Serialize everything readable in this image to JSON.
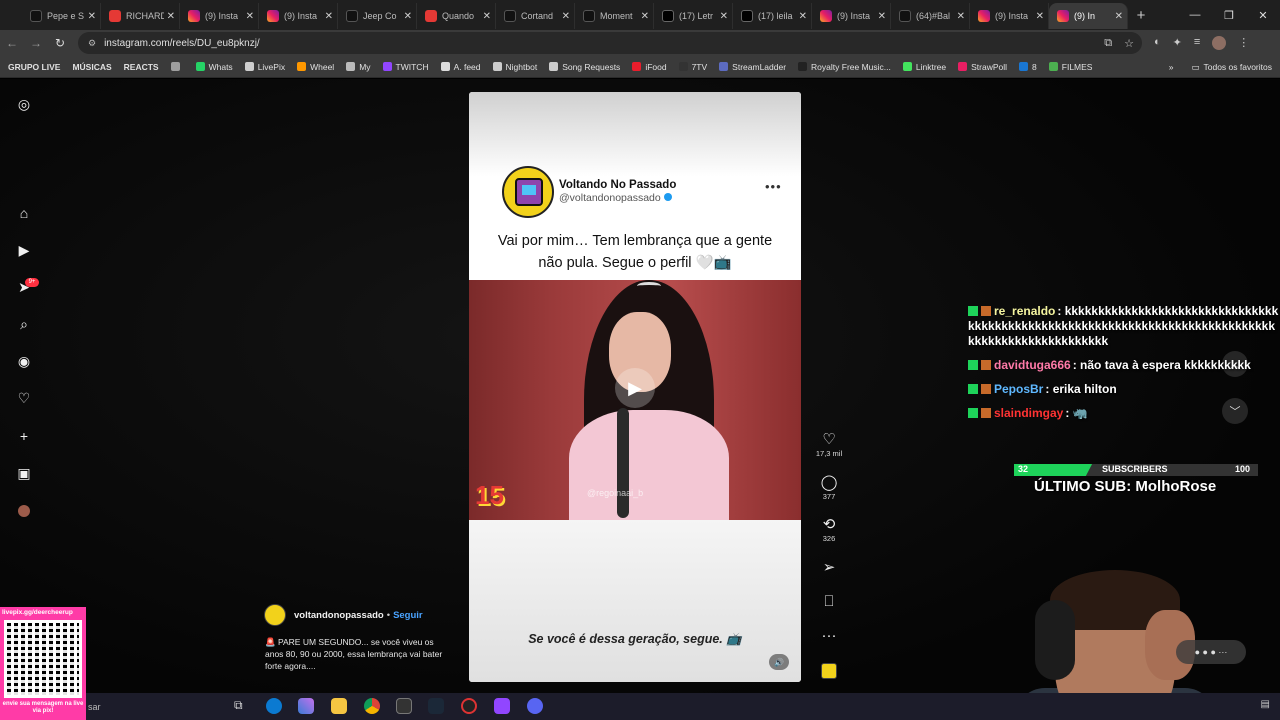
{
  "tabs": [
    {
      "label": "Pepe e S",
      "icon": "tiktok-icon",
      "kind": "tt"
    },
    {
      "label": "RICHARD",
      "icon": "youtube-icon",
      "kind": "yt"
    },
    {
      "label": "(9) Insta",
      "icon": "instagram-icon",
      "kind": "ig"
    },
    {
      "label": "(9) Insta",
      "icon": "instagram-icon",
      "kind": "ig"
    },
    {
      "label": "Jeep Co",
      "icon": "tiktok-icon",
      "kind": "tt"
    },
    {
      "label": "Quando",
      "icon": "youtube-icon",
      "kind": "yt"
    },
    {
      "label": "Cortand",
      "icon": "tiktok-icon",
      "kind": "tt"
    },
    {
      "label": "Moment",
      "icon": "tiktok-icon",
      "kind": "tt"
    },
    {
      "label": "(17) Letr",
      "icon": "x-icon",
      "kind": "xx"
    },
    {
      "label": "(17) leila",
      "icon": "x-icon",
      "kind": "xx"
    },
    {
      "label": "(9) Insta",
      "icon": "instagram-icon",
      "kind": "ig"
    },
    {
      "label": "(64)#Bal",
      "icon": "tiktok-icon",
      "kind": "tt"
    },
    {
      "label": "(9) Insta",
      "icon": "instagram-icon",
      "kind": "ig"
    },
    {
      "label": "(9) In",
      "icon": "instagram-icon",
      "kind": "ig",
      "active": true
    }
  ],
  "address": {
    "url": "instagram.com/reels/DU_eu8pknzj/"
  },
  "bookmarks": [
    {
      "label": "GRUPO LIVE",
      "bold": true,
      "color": ""
    },
    {
      "label": "MÚSICAS",
      "bold": true,
      "color": ""
    },
    {
      "label": "REACTS",
      "bold": true,
      "color": ""
    },
    {
      "label": "",
      "bold": false,
      "color": "#9e9e9e"
    },
    {
      "label": "Whats",
      "bold": false,
      "color": "#25d366"
    },
    {
      "label": "LivePix",
      "bold": false,
      "color": "#cfcfcf"
    },
    {
      "label": "Wheel",
      "bold": false,
      "color": "#ff9800"
    },
    {
      "label": "My",
      "bold": false,
      "color": "#bbbbbb"
    },
    {
      "label": "TWITCH",
      "bold": false,
      "color": "#9146ff"
    },
    {
      "label": "A. feed",
      "bold": false,
      "color": "#dddddd"
    },
    {
      "label": "Nightbot",
      "bold": false,
      "color": "#cccccc"
    },
    {
      "label": "Song Requests",
      "bold": false,
      "color": "#cccccc"
    },
    {
      "label": "iFood",
      "bold": false,
      "color": "#ea1d2c"
    },
    {
      "label": "7TV",
      "bold": false,
      "color": "#333333"
    },
    {
      "label": "StreamLadder",
      "bold": false,
      "color": "#5c6bc0"
    },
    {
      "label": "Royalty Free Music...",
      "bold": false,
      "color": "#222222"
    },
    {
      "label": "Linktree",
      "bold": false,
      "color": "#43e55e"
    },
    {
      "label": "StrawPoll",
      "bold": false,
      "color": "#e91e63"
    },
    {
      "label": "8",
      "bold": false,
      "color": "#1976d2"
    },
    {
      "label": "FILMES",
      "bold": false,
      "color": "#4caf50"
    }
  ],
  "bookmarks_all": "Todos os favoritos",
  "reel": {
    "name": "Voltando No Passado",
    "handle": "@voltandonopassado",
    "caption": "Vai por mim… Tem lembrança que a gente não pula. Segue o perfil 🤍📺",
    "video_number": "15",
    "watermark": "@regoinaai_b",
    "subcaption": "Se você é dessa geração, segue. 📺"
  },
  "actions": {
    "likes": "17,3 mil",
    "comments": "377",
    "reposts": "326"
  },
  "author": {
    "name": "voltandonopassado",
    "follow": "Seguir",
    "description": "🚨 PARE UM SEGUNDO... se você viveu os anos 80, 90 ou 2000, essa lembrança vai bater forte agora...."
  },
  "nav": {
    "notifications_badge": "9+"
  },
  "chat": [
    {
      "user": "re_renaldo",
      "color": "#f5f5a0",
      "message": "kkkkkkkkkkkkkkkkkkkkkkkkkkkkkkkkkkkkkkkkkkkkkkkkkkkkkkkkkkkkkkkkkkkkkkkkkkkkkkkkkkkkkkkkkkkkkkkkkkk"
    },
    {
      "user": "davidtuga666",
      "color": "#ff7aa8",
      "message": "não tava à espera kkkkkkkkkk"
    },
    {
      "user": "PeposBr",
      "color": "#5fb8ff",
      "message": "erika hilton"
    },
    {
      "user": "slaindimgay",
      "color": "#ff3333",
      "message": "🦏"
    }
  ],
  "subs": {
    "count": "32",
    "label": "SUBSCRIBERS",
    "goal": "100",
    "fraction": 0.32,
    "last": "ÚLTIMO SUB: MolhoRose"
  },
  "qr": {
    "url": "livepix.gg/deercheerup",
    "caption": "envie sua mensagem na live via pix!"
  },
  "taskbar": {
    "search": "sar"
  }
}
